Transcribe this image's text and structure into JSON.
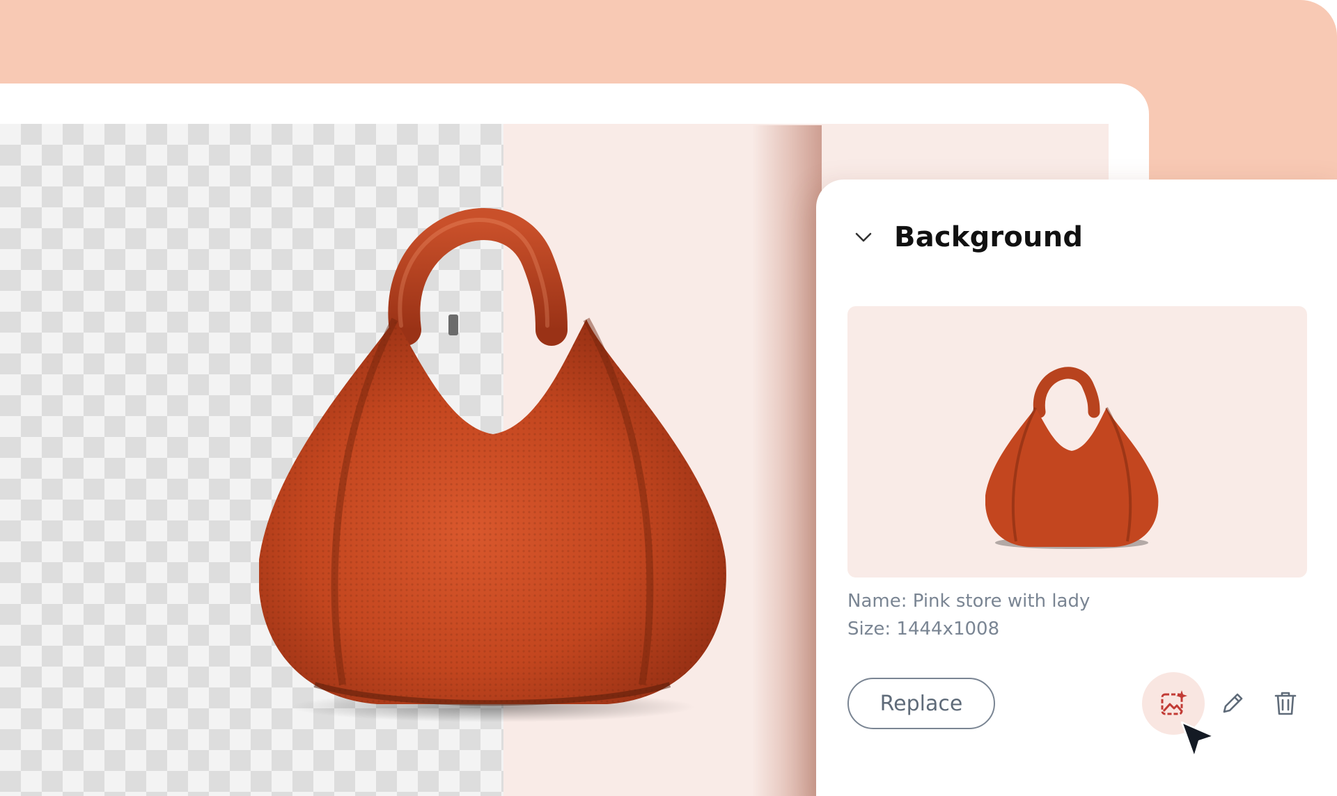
{
  "panel": {
    "title": "Background",
    "collapse_icon": "chevron-down-icon",
    "preview_image": "handbag-on-pink-background",
    "name_line": "Name: Pink store with lady",
    "size_line": "Size: 1444x1008",
    "replace_label": "Replace",
    "actions": [
      "ai-image-icon",
      "pencil-icon",
      "trash-icon"
    ]
  },
  "canvas": {
    "left_half": "transparent-checkerboard",
    "right_half": "pink-backdrop",
    "subject": "orange-leather-handbag"
  },
  "colors": {
    "header_band": "#f8c9b4",
    "pink_backdrop": "#f9ebe7",
    "bag_main": "#c8471f",
    "accent_icon": "#c23b35",
    "muted_text": "#7a8593"
  }
}
